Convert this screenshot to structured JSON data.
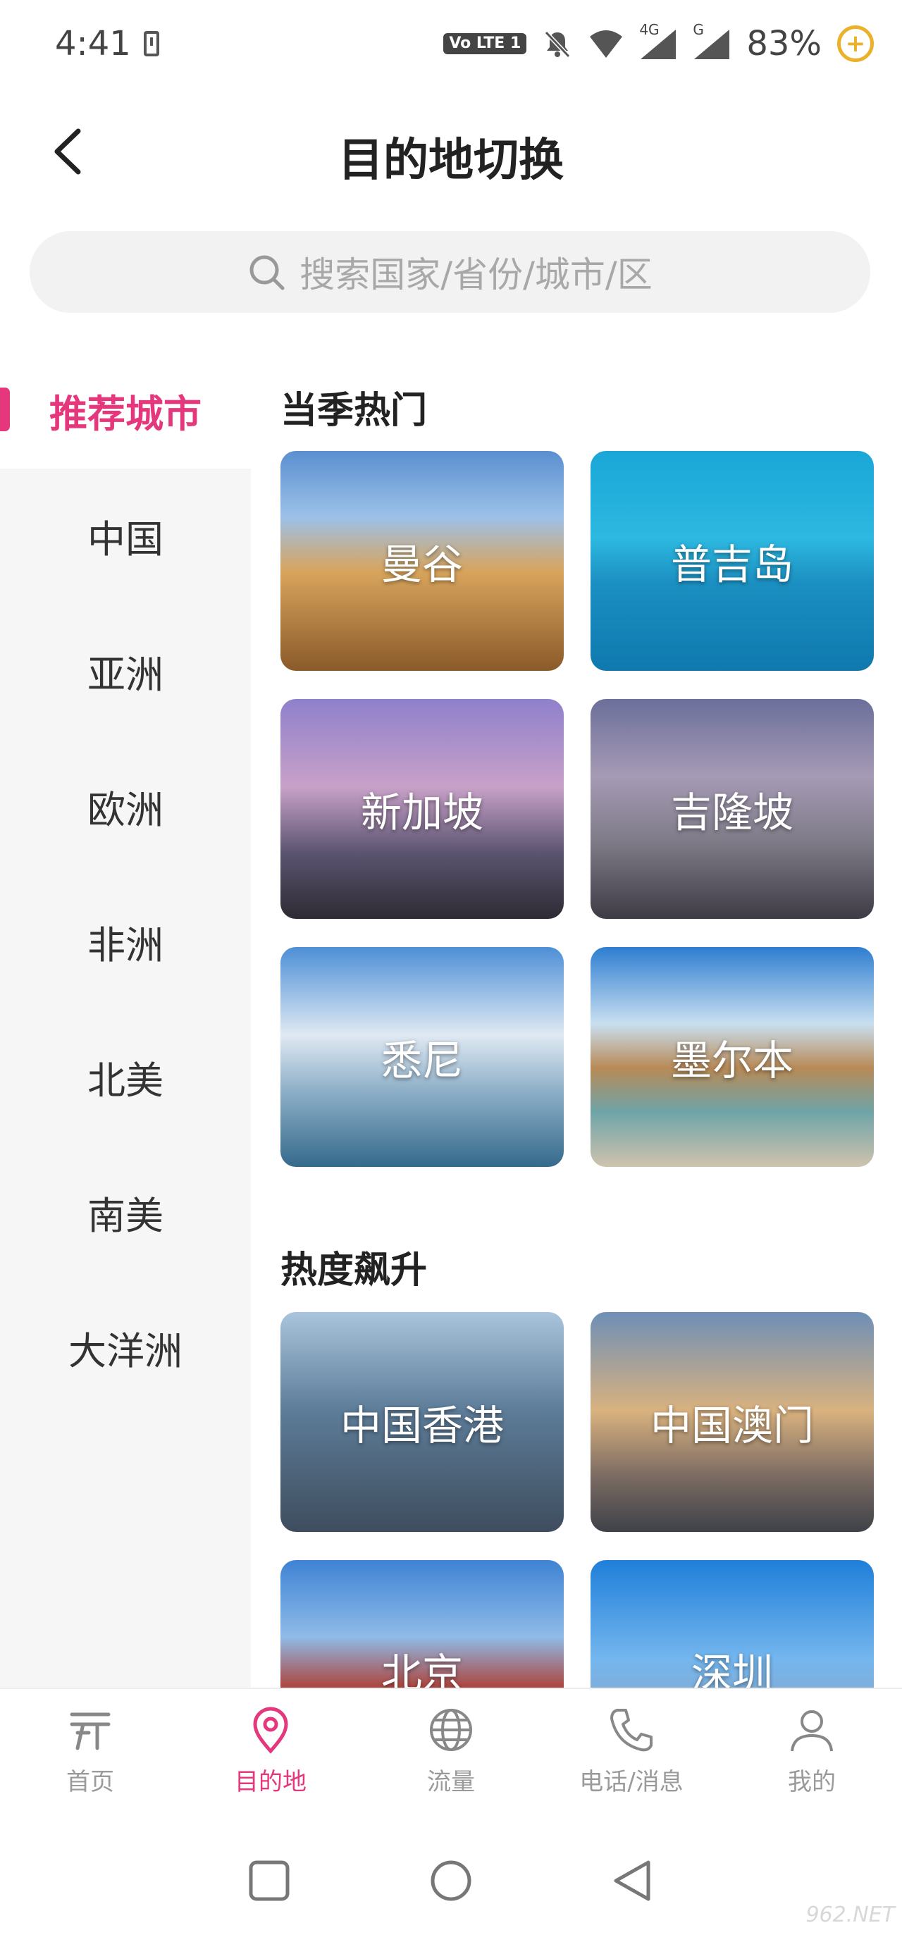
{
  "status_bar": {
    "time": "4:41",
    "volte": "Vo LTE 1",
    "signal_1": "4G",
    "signal_2": "G",
    "battery": "83%",
    "battery_badge": "+"
  },
  "header": {
    "title": "目的地切换"
  },
  "search": {
    "placeholder": "搜索国家/省份/城市/区"
  },
  "sidebar": {
    "items": [
      {
        "label": "推荐城市",
        "active": true
      },
      {
        "label": "中国"
      },
      {
        "label": "亚洲"
      },
      {
        "label": "欧洲"
      },
      {
        "label": "非洲"
      },
      {
        "label": "北美"
      },
      {
        "label": "南美"
      },
      {
        "label": "大洋洲"
      }
    ]
  },
  "sections": [
    {
      "title": "当季热门",
      "cards": [
        {
          "label": "曼谷"
        },
        {
          "label": "普吉岛"
        },
        {
          "label": "新加坡"
        },
        {
          "label": "吉隆坡"
        },
        {
          "label": "悉尼"
        },
        {
          "label": "墨尔本"
        }
      ]
    },
    {
      "title": "热度飙升",
      "cards": [
        {
          "label": "中国香港"
        },
        {
          "label": "中国澳门"
        },
        {
          "label": "北京"
        },
        {
          "label": "深圳"
        }
      ]
    }
  ],
  "bottom_nav": [
    {
      "label": "首页",
      "icon": "home-icon"
    },
    {
      "label": "目的地",
      "icon": "location-pin-icon",
      "active": true
    },
    {
      "label": "流量",
      "icon": "globe-icon"
    },
    {
      "label": "电话/消息",
      "icon": "phone-icon"
    },
    {
      "label": "我的",
      "icon": "person-icon"
    }
  ],
  "watermark": "962.NET",
  "colors": {
    "accent": "#e5387c",
    "sidebar_bg": "#f6f6f6",
    "search_bg": "#f2f2f2",
    "inactive": "#9a9a9a"
  }
}
